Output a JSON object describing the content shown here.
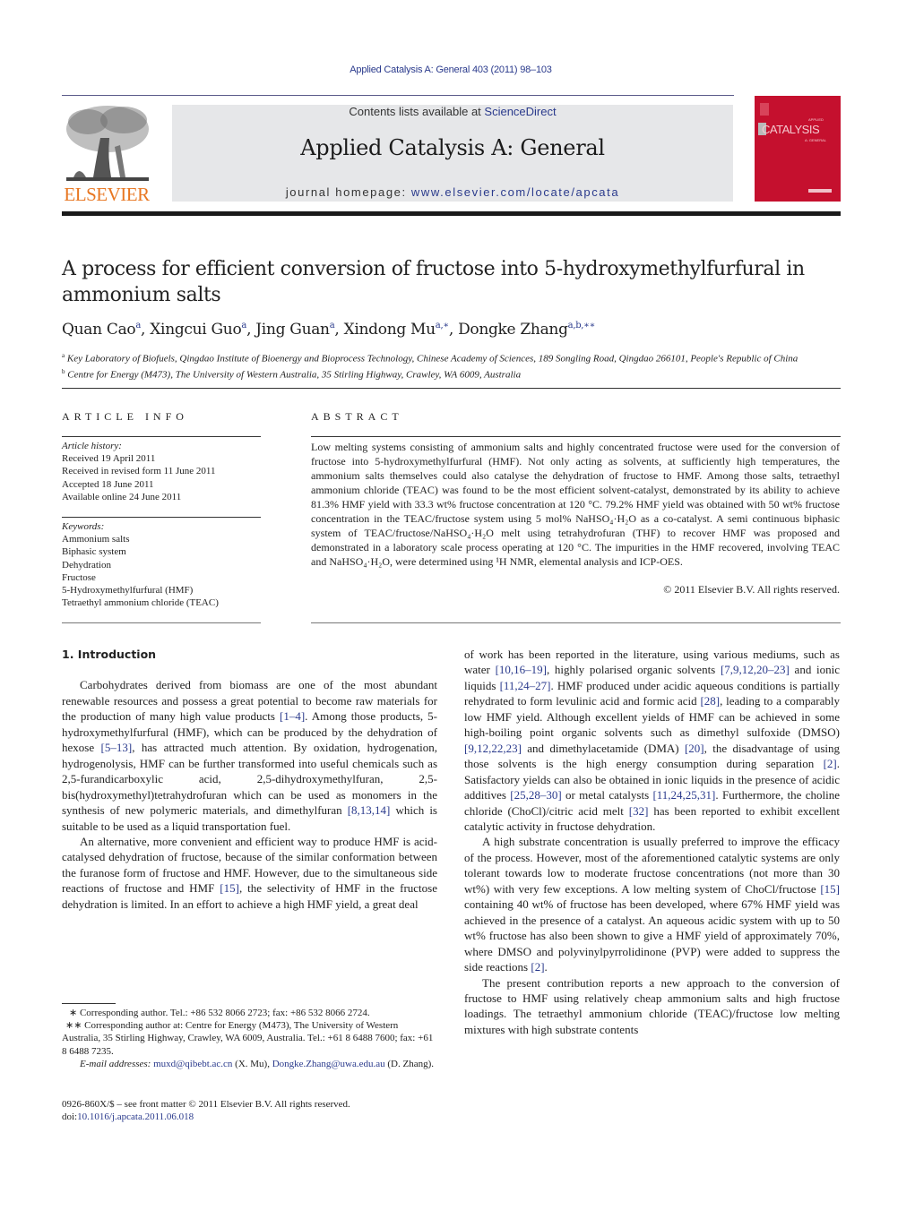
{
  "journal_ref": "Applied Catalysis A: General 403 (2011) 98–103",
  "header": {
    "publisher": "ELSEVIER",
    "contents_prefix": "Contents lists available at ",
    "contents_link": "ScienceDirect",
    "journal_title": "Applied Catalysis A: General",
    "homepage_prefix": "journal homepage: ",
    "homepage_link": "www.elsevier.com/locate/apcata",
    "cover_title": "CATALYSIS",
    "cover_top": "APPLIED",
    "cover_sub": "A: GENERAL",
    "colors": {
      "brand_orange": "#e87722",
      "link_blue": "#2a3a8c",
      "cover_red": "#c5102e",
      "masthead_grey": "#e6e7e9"
    }
  },
  "article": {
    "title": "A process for efficient conversion of fructose into 5-hydroxymethylfurfural in ammonium salts",
    "authors": [
      {
        "name": "Quan Cao",
        "sup": "a"
      },
      {
        "name": "Xingcui Guo",
        "sup": "a"
      },
      {
        "name": "Jing Guan",
        "sup": "a"
      },
      {
        "name": "Xindong Mu",
        "sup": "a,∗"
      },
      {
        "name": "Dongke Zhang",
        "sup": "a,b,∗∗"
      }
    ],
    "affiliations": [
      {
        "mark": "a",
        "text": "Key Laboratory of Biofuels, Qingdao Institute of Bioenergy and Bioprocess Technology, Chinese Academy of Sciences, 189 Songling Road, Qingdao 266101, People's Republic of China"
      },
      {
        "mark": "b",
        "text": "Centre for Energy (M473), The University of Western Australia, 35 Stirling Highway, Crawley, WA 6009, Australia"
      }
    ]
  },
  "article_info": {
    "heading": "ARTICLE INFO",
    "history_label": "Article history:",
    "history": [
      "Received 19 April 2011",
      "Received in revised form 11 June 2011",
      "Accepted 18 June 2011",
      "Available online 24 June 2011"
    ],
    "keywords_label": "Keywords:",
    "keywords": [
      "Ammonium salts",
      "Biphasic system",
      "Dehydration",
      "Fructose",
      "5-Hydroxymethylfurfural (HMF)",
      "Tetraethyl ammonium chloride (TEAC)"
    ]
  },
  "abstract": {
    "heading": "ABSTRACT",
    "text": "Low melting systems consisting of ammonium salts and highly concentrated fructose were used for the conversion of fructose into 5-hydroxymethylfurfural (HMF). Not only acting as solvents, at sufficiently high temperatures, the ammonium salts themselves could also catalyse the dehydration of fructose to HMF. Among those salts, tetraethyl ammonium chloride (TEAC) was found to be the most efficient solvent-catalyst, demonstrated by its ability to achieve 81.3% HMF yield with 33.3 wt% fructose concentration at 120 °C. 79.2% HMF yield was obtained with 50 wt% fructose concentration in the TEAC/fructose system using 5 mol% NaHSO₄·H₂O as a co-catalyst. A semi continuous biphasic system of TEAC/fructose/NaHSO₄·H₂O melt using tetrahydrofuran (THF) to recover HMF was proposed and demonstrated in a laboratory scale process operating at 120 °C. The impurities in the HMF recovered, involving TEAC and NaHSO₄·H₂O, were determined using ¹H NMR, elemental analysis and ICP-OES.",
    "copyright": "© 2011 Elsevier B.V. All rights reserved."
  },
  "body": {
    "section_heading": "1.  Introduction",
    "left_paragraphs": [
      [
        {
          "t": "Carbohydrates derived from biomass are one of the most abundant renewable resources and possess a great potential to become raw materials for the production of many high value products "
        },
        {
          "ref": "[1–4]"
        },
        {
          "t": ". Among those products, 5-hydroxymethylfurfural (HMF), which can be produced by the dehydration of hexose "
        },
        {
          "ref": "[5–13]"
        },
        {
          "t": ", has attracted much attention. By oxidation, hydrogenation, hydrogenolysis, HMF can be further transformed into useful chemicals such as 2,5-furandicarboxylic acid, 2,5-dihydroxymethylfuran, 2,5-bis(hydroxymethyl)tetrahydrofuran which can be used as monomers in the synthesis of new polymeric materials, and dimethylfuran "
        },
        {
          "ref": "[8,13,14]"
        },
        {
          "t": " which is suitable to be used as a liquid transportation fuel."
        }
      ],
      [
        {
          "t": "An alternative, more convenient and efficient way to produce HMF is acid-catalysed dehydration of fructose, because of the similar conformation between the furanose form of fructose and HMF. However, due to the simultaneous side reactions of fructose and HMF "
        },
        {
          "ref": "[15]"
        },
        {
          "t": ", the selectivity of HMF in the fructose dehydration is limited. In an effort to achieve a high HMF yield, a great deal"
        }
      ]
    ],
    "right_paragraphs": [
      [
        {
          "t": "of work has been reported in the literature, using various mediums, such as water "
        },
        {
          "ref": "[10,16–19]"
        },
        {
          "t": ", highly polarised organic solvents "
        },
        {
          "ref": "[7,9,12,20–23]"
        },
        {
          "t": " and ionic liquids "
        },
        {
          "ref": "[11,24–27]"
        },
        {
          "t": ". HMF produced under acidic aqueous conditions is partially rehydrated to form levulinic acid and formic acid "
        },
        {
          "ref": "[28]"
        },
        {
          "t": ", leading to a comparably low HMF yield. Although excellent yields of HMF can be achieved in some high-boiling point organic solvents such as dimethyl sulfoxide (DMSO) "
        },
        {
          "ref": "[9,12,22,23]"
        },
        {
          "t": " and dimethylacetamide (DMA) "
        },
        {
          "ref": "[20]"
        },
        {
          "t": ", the disadvantage of using those solvents is the high energy consumption during separation "
        },
        {
          "ref": "[2]"
        },
        {
          "t": ". Satisfactory yields can also be obtained in ionic liquids in the presence of acidic additives "
        },
        {
          "ref": "[25,28–30]"
        },
        {
          "t": " or metal catalysts "
        },
        {
          "ref": "[11,24,25,31]"
        },
        {
          "t": ". Furthermore, the choline chloride (ChoCl)/citric acid melt "
        },
        {
          "ref": "[32]"
        },
        {
          "t": " has been reported to exhibit excellent catalytic activity in fructose dehydration."
        }
      ],
      [
        {
          "t": "A high substrate concentration is usually preferred to improve the efficacy of the process. However, most of the aforementioned catalytic systems are only tolerant towards low to moderate fructose concentrations (not more than 30 wt%) with very few exceptions. A low melting system of ChoCl/fructose "
        },
        {
          "ref": "[15]"
        },
        {
          "t": " containing 40 wt% of fructose has been developed, where 67% HMF yield was achieved in the presence of a catalyst. An aqueous acidic system with up to 50 wt% fructose has also been shown to give a HMF yield of approximately 70%, where DMSO and polyvinylpyrrolidinone (PVP) were added to suppress the side reactions "
        },
        {
          "ref": "[2]"
        },
        {
          "t": "."
        }
      ],
      [
        {
          "t": "The present contribution reports a new approach to the conversion of fructose to HMF using relatively cheap ammonium salts and high fructose loadings. The tetraethyl ammonium chloride (TEAC)/fructose low melting mixtures with high substrate contents"
        }
      ]
    ]
  },
  "footnotes": {
    "fn1": "∗  Corresponding author. Tel.: +86 532 8066 2723; fax: +86 532 8066 2724.",
    "fn2": "∗∗  Corresponding author at: Centre for Energy (M473), The University of Western Australia, 35 Stirling Highway, Crawley, WA 6009, Australia. Tel.: +61 8 6488 7600; fax: +61 8 6488 7235.",
    "email_label": "E-mail addresses:",
    "email1": "muxd@qibebt.ac.cn",
    "email1_who": " (X. Mu), ",
    "email2": "Dongke.Zhang@uwa.edu.au",
    "email2_who": " (D. Zhang)."
  },
  "front_matter": {
    "issn_line": "0926-860X/$ – see front matter © 2011 Elsevier B.V. All rights reserved.",
    "doi_prefix": "doi:",
    "doi": "10.1016/j.apcata.2011.06.018"
  }
}
